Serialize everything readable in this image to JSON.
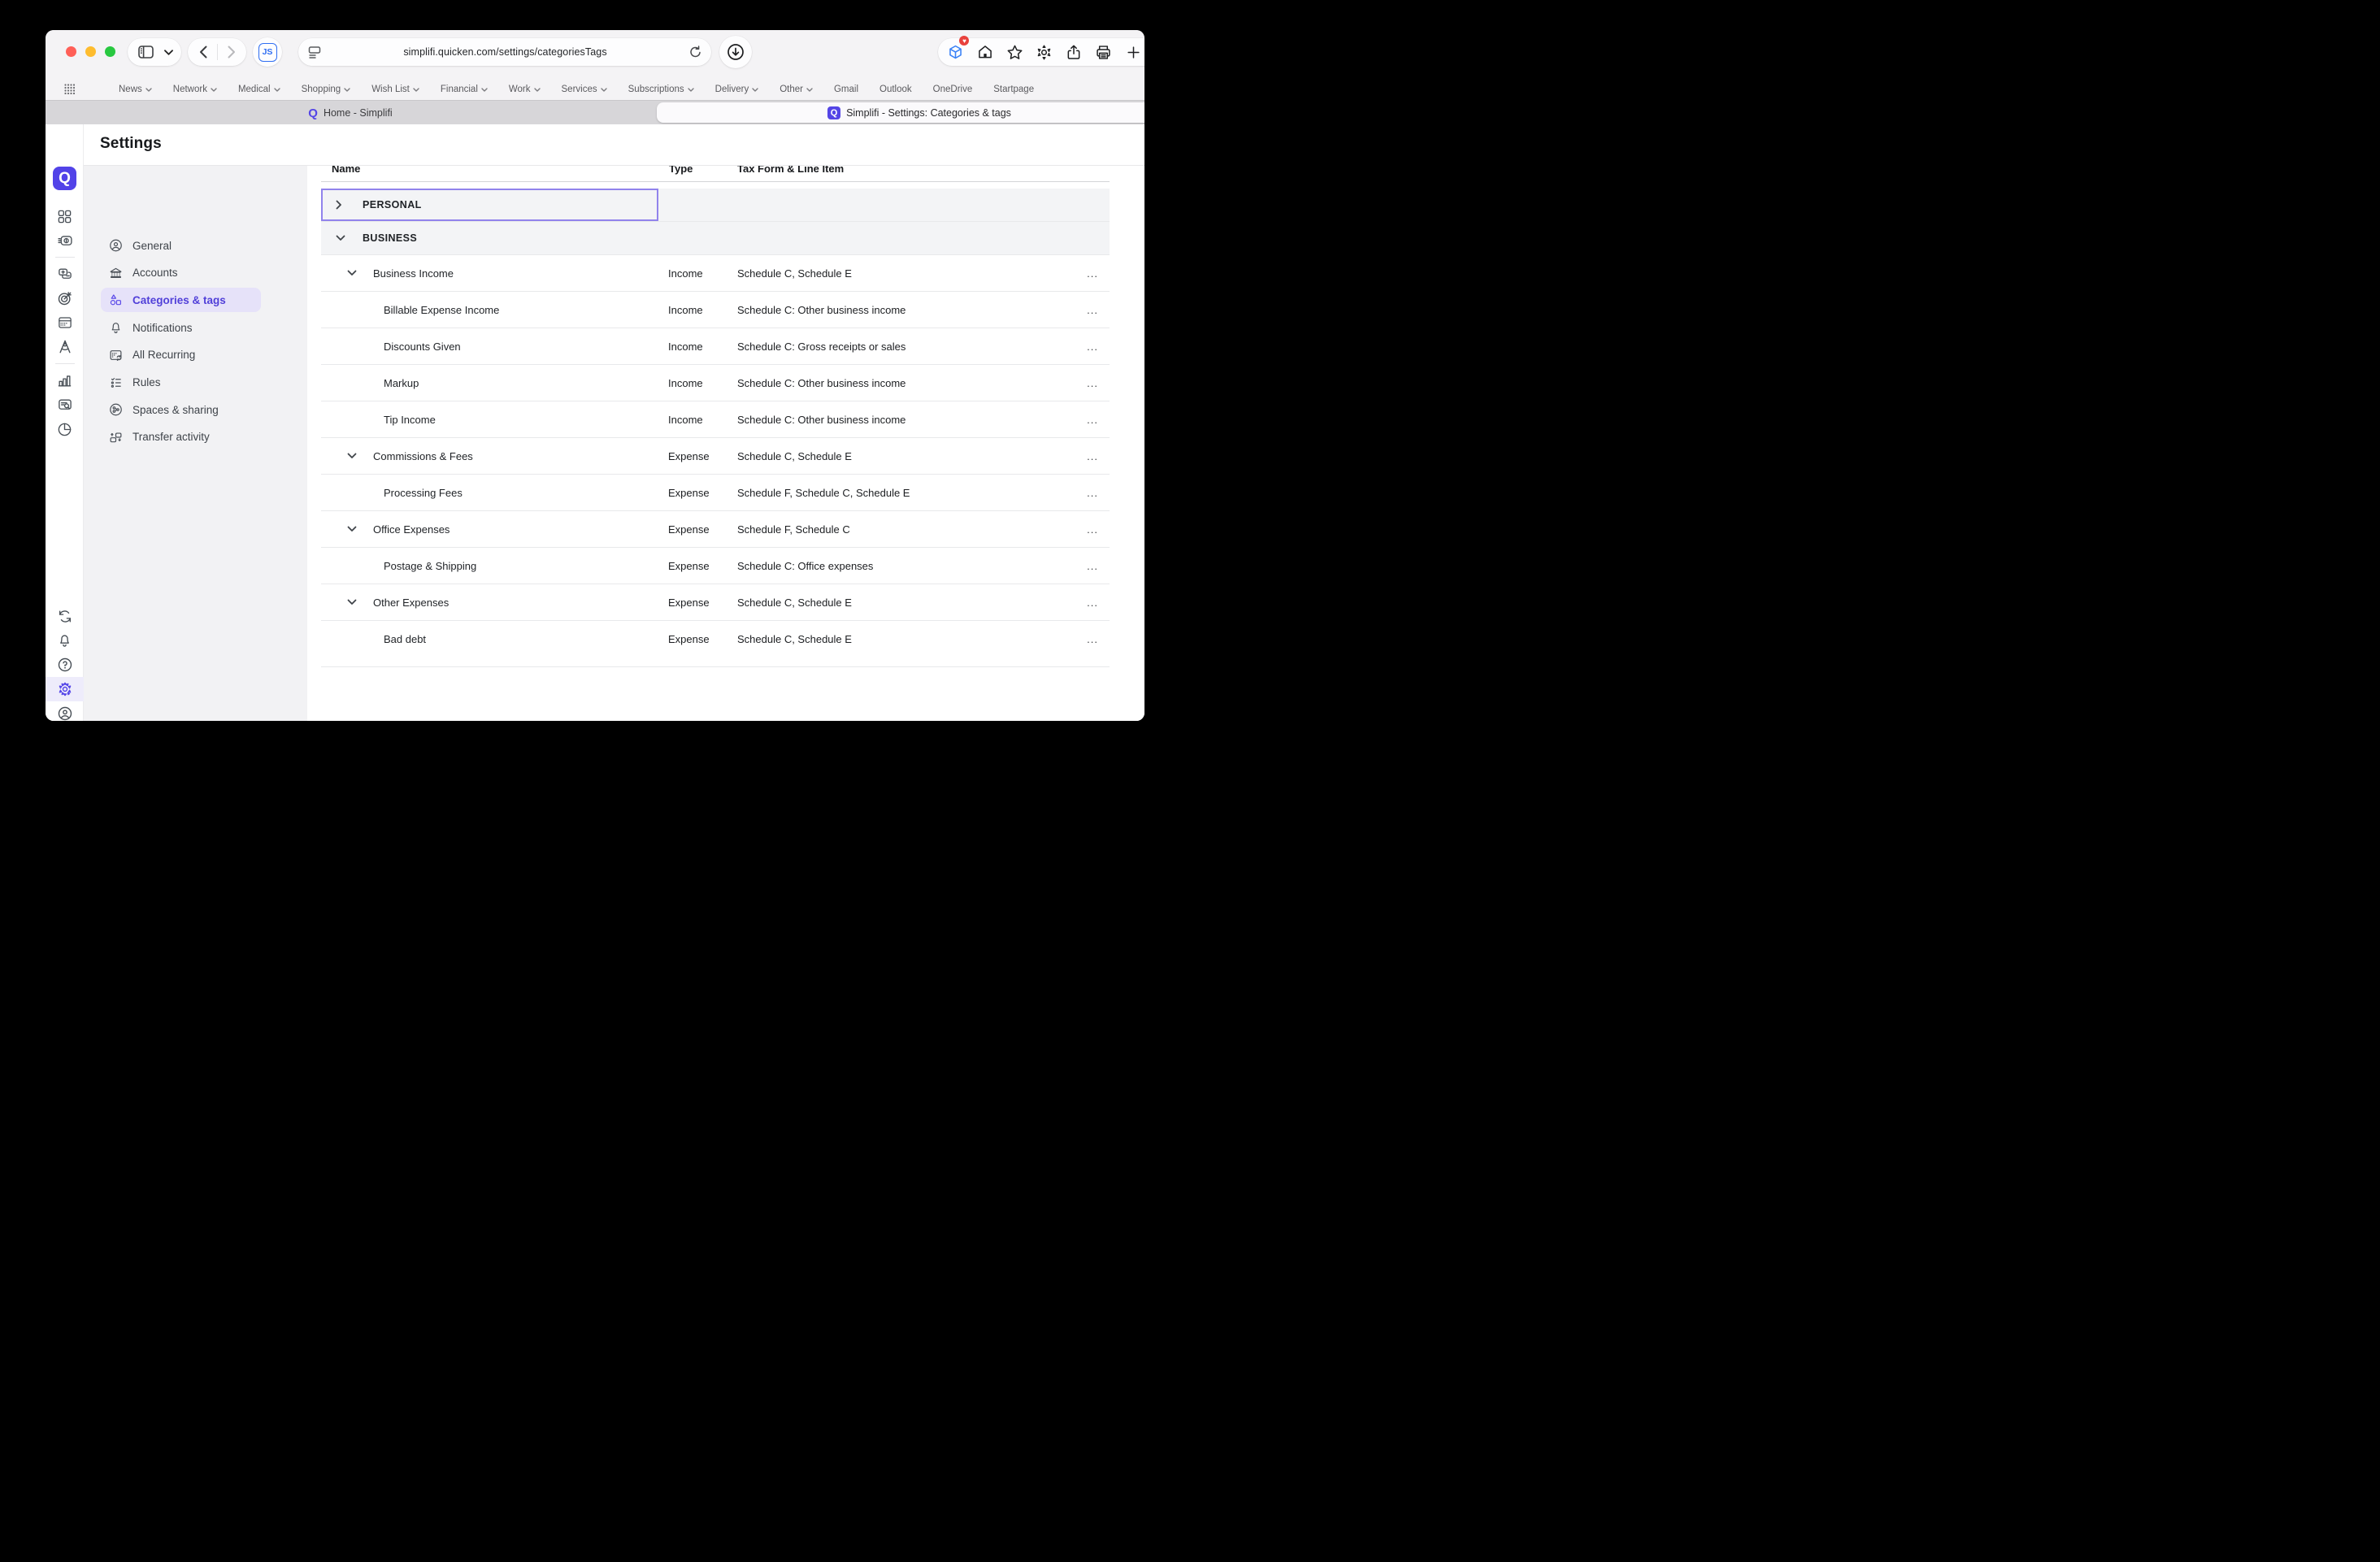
{
  "browser": {
    "url": "simplifi.quicken.com/settings/categoriesTags",
    "toolbar_icons_right": [
      "extension-cube-icon",
      "home-icon",
      "star-icon",
      "gear-icon",
      "share-icon",
      "print-icon",
      "new-tab-icon",
      "tab-overview-icon"
    ],
    "bookmarks": [
      {
        "label": "News",
        "chevron": true
      },
      {
        "label": "Network",
        "chevron": true
      },
      {
        "label": "Medical",
        "chevron": true
      },
      {
        "label": "Shopping",
        "chevron": true
      },
      {
        "label": "Wish List",
        "chevron": true
      },
      {
        "label": "Financial",
        "chevron": true
      },
      {
        "label": "Work",
        "chevron": true
      },
      {
        "label": "Services",
        "chevron": true
      },
      {
        "label": "Subscriptions",
        "chevron": true
      },
      {
        "label": "Delivery",
        "chevron": true
      },
      {
        "label": "Other",
        "chevron": true
      },
      {
        "label": "Gmail",
        "chevron": false
      },
      {
        "label": "Outlook",
        "chevron": false
      },
      {
        "label": "OneDrive",
        "chevron": false
      },
      {
        "label": "Startpage",
        "chevron": false
      }
    ],
    "tabs": [
      {
        "title": "Home - Simplifi",
        "active": false
      },
      {
        "title": "Simplifi - Settings: Categories & tags",
        "active": true
      }
    ]
  },
  "app": {
    "logo_letter": "Q",
    "title": "Settings",
    "rail_top": [
      "dashboard-grid-icon",
      "cashflow-icon",
      "divider",
      "transactions-icon",
      "goals-target-icon",
      "spending-plan-icon",
      "planning-compass-icon",
      "divider",
      "reports-icon",
      "search-transactions-icon",
      "pie-chart-icon"
    ],
    "rail_bottom": [
      {
        "icon": "sync-icon",
        "active": false
      },
      {
        "icon": "bell-icon",
        "active": false
      },
      {
        "icon": "help-icon",
        "active": false
      },
      {
        "icon": "settings-gear-icon",
        "active": true
      },
      {
        "icon": "account-icon",
        "active": false
      }
    ],
    "nav": [
      {
        "label": "General",
        "icon": "person-icon",
        "selected": false
      },
      {
        "label": "Accounts",
        "icon": "bank-icon",
        "selected": false
      },
      {
        "label": "Categories & tags",
        "icon": "shapes-icon",
        "selected": true
      },
      {
        "label": "Notifications",
        "icon": "bell-icon",
        "selected": false
      },
      {
        "label": "All Recurring",
        "icon": "recurring-icon",
        "selected": false
      },
      {
        "label": "Rules",
        "icon": "rules-icon",
        "selected": false
      },
      {
        "label": "Spaces & sharing",
        "icon": "spaces-icon",
        "selected": false
      },
      {
        "label": "Transfer activity",
        "icon": "transfer-icon",
        "selected": false
      }
    ],
    "table": {
      "columns": [
        "Name",
        "Type",
        "Tax Form & Line Item"
      ],
      "rows": [
        {
          "name": "PERSONAL",
          "level": 0,
          "section": true,
          "chevron": "right",
          "type": "",
          "tax": "",
          "dots": false,
          "focused": true
        },
        {
          "name": "BUSINESS",
          "level": 0,
          "section": true,
          "chevron": "down",
          "type": "",
          "tax": "",
          "dots": false
        },
        {
          "name": "Business Income",
          "level": 1,
          "chevron": "down",
          "type": "Income",
          "tax": "Schedule C, Schedule E",
          "dots": true
        },
        {
          "name": "Billable Expense Income",
          "level": 2,
          "type": "Income",
          "tax": "Schedule C: Other business income",
          "dots": true
        },
        {
          "name": "Discounts Given",
          "level": 2,
          "type": "Income",
          "tax": "Schedule C: Gross receipts or sales",
          "dots": true
        },
        {
          "name": "Markup",
          "level": 2,
          "type": "Income",
          "tax": "Schedule C: Other business income",
          "dots": true
        },
        {
          "name": "Tip Income",
          "level": 2,
          "type": "Income",
          "tax": "Schedule C: Other business income",
          "dots": true
        },
        {
          "name": "Commissions & Fees",
          "level": 1,
          "chevron": "down",
          "type": "Expense",
          "tax": "Schedule C, Schedule E",
          "dots": true
        },
        {
          "name": "Processing Fees",
          "level": 2,
          "type": "Expense",
          "tax": "Schedule F, Schedule C, Schedule E",
          "dots": true
        },
        {
          "name": "Office Expenses",
          "level": 1,
          "chevron": "down",
          "type": "Expense",
          "tax": "Schedule F, Schedule C",
          "dots": true
        },
        {
          "name": "Postage & Shipping",
          "level": 2,
          "type": "Expense",
          "tax": "Schedule C: Office expenses",
          "dots": true
        },
        {
          "name": "Other Expenses",
          "level": 1,
          "chevron": "down",
          "type": "Expense",
          "tax": "Schedule C, Schedule E",
          "dots": true
        },
        {
          "name": "Bad debt",
          "level": 2,
          "type": "Expense",
          "tax": "Schedule C, Schedule E",
          "dots": true
        }
      ]
    },
    "colors": {
      "accent_purple": "#5243e8",
      "selected_nav_bg": "#e6e2f9",
      "focus_ring": "#9183ec",
      "traffic_red": "#ff5f57",
      "traffic_yellow": "#febc2e",
      "traffic_green": "#28c840",
      "js_blue": "#2f6ef2"
    }
  }
}
